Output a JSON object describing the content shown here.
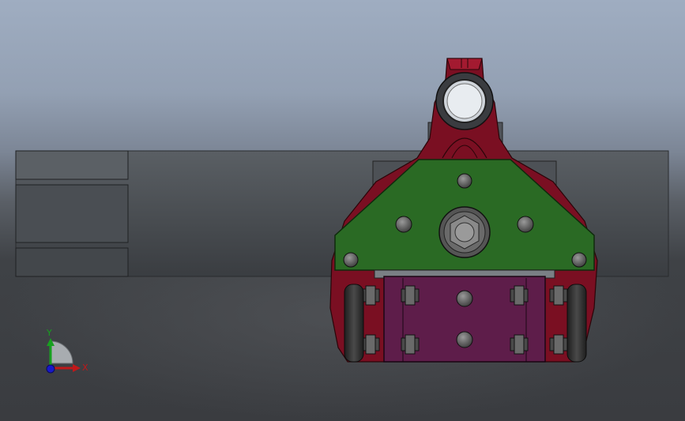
{
  "viewport": {
    "background_top": "#9fadc1",
    "background_bottom": "#3a3c40"
  },
  "triad": {
    "x_label": "X",
    "y_label": "Y",
    "x_color": "#c0181a",
    "y_color": "#18a020",
    "z_color": "#1818c8"
  },
  "model": {
    "colors": {
      "housing": "#7a0f22",
      "plate": "#2a6a24",
      "block": "#5e1d4a",
      "bolt": "#6b6b6b",
      "wheel": "#2b2b2b",
      "frame": "#44484c"
    },
    "icons": [
      "bolt-icon",
      "nut-icon",
      "wheel-icon"
    ]
  }
}
